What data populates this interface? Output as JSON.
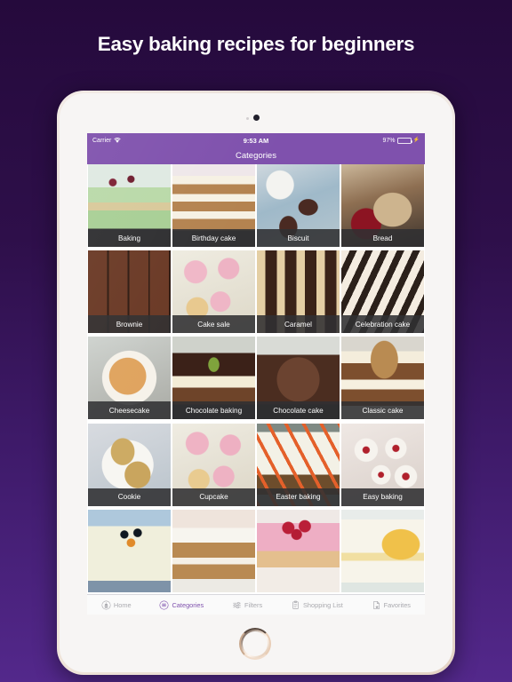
{
  "headline": "Easy baking recipes for beginners",
  "device": {
    "name": "tablet-frame",
    "bezel_color": "#efe4da",
    "home_button": "home-button"
  },
  "status_bar": {
    "carrier": "Carrier",
    "wifi_icon": "wifi-icon",
    "time": "9:53 AM",
    "battery_percent": "97%",
    "battery_color": "#4cd964",
    "charging_icon": "charging-bolt-icon"
  },
  "nav_bar": {
    "title": "Categories",
    "color": "#7f51ad"
  },
  "grid": {
    "tiles": [
      {
        "label": "Baking",
        "image": "pistachio-layer-cake-with-cherries"
      },
      {
        "label": "Birthday cake",
        "image": "sprinkle-layer-cake-with-buttercream"
      },
      {
        "label": "Biscuit",
        "image": "chocolate-sandwich-biscuits-with-milk"
      },
      {
        "label": "Bread",
        "image": "seeded-bread-loaf-with-jam"
      },
      {
        "label": "Brownie",
        "image": "chocolate-brownie-squares"
      },
      {
        "label": "Cake sale",
        "image": "pink-iced-fairy-cakes"
      },
      {
        "label": "Caramel",
        "image": "caramel-millionaire-shortbread"
      },
      {
        "label": "Celebration cake",
        "image": "striped-cream-celebration-cake"
      },
      {
        "label": "Cheesecake",
        "image": "peach-topped-cheesecake"
      },
      {
        "label": "Chocolate baking",
        "image": "chocolate-pistachio-sponge"
      },
      {
        "label": "Chocolate cake",
        "image": "chocolate-fudge-cake-with-shards"
      },
      {
        "label": "Classic cake",
        "image": "carrot-cake-with-walnuts"
      },
      {
        "label": "Cookie",
        "image": "oat-raisin-cookies-on-plate"
      },
      {
        "label": "Cupcake",
        "image": "pink-iced-cupcakes"
      },
      {
        "label": "Easter baking",
        "image": "carrot-traybake-with-icing"
      },
      {
        "label": "Easy baking",
        "image": "cherry-bakewell-tarts"
      },
      {
        "label": "",
        "image": "snowman-christmas-cake"
      },
      {
        "label": "",
        "image": "dusted-victoria-sponge"
      },
      {
        "label": "",
        "image": "raspberry-topped-pink-cake"
      },
      {
        "label": "",
        "image": "lemon-layer-cake-with-slices"
      }
    ]
  },
  "tab_bar": {
    "active_color": "#7f51ad",
    "inactive_color": "#a9a9ae",
    "items": [
      {
        "label": "Home",
        "icon": "home-cupcake-icon",
        "active": false
      },
      {
        "label": "Categories",
        "icon": "categories-icon",
        "active": true
      },
      {
        "label": "Filters",
        "icon": "filters-sliders-icon",
        "active": false
      },
      {
        "label": "Shopping List",
        "icon": "clipboard-icon",
        "active": false
      },
      {
        "label": "Favorites",
        "icon": "page-star-icon",
        "active": false
      }
    ]
  }
}
